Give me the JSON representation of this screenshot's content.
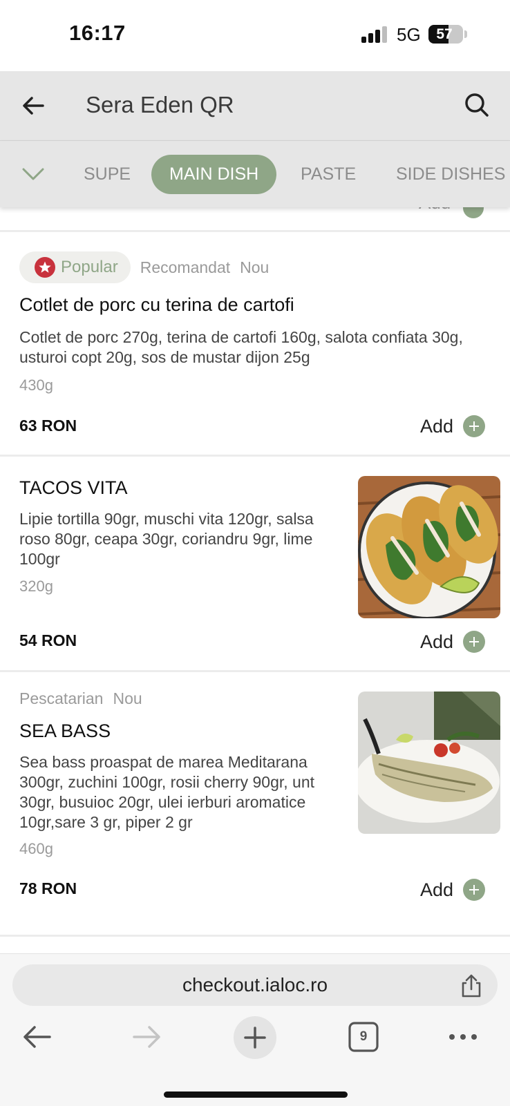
{
  "status_bar": {
    "time": "16:17",
    "network": "5G",
    "battery": "57",
    "battery_level": 0.57
  },
  "header": {
    "title": "Sera Eden QR",
    "back_icon": "arrow-left-icon",
    "search_icon": "search-icon"
  },
  "categories": {
    "chevron_icon": "chevron-down-icon",
    "items": [
      {
        "label": "SUPE",
        "active": false
      },
      {
        "label": "MAIN DISH",
        "active": true
      },
      {
        "label": "PASTE",
        "active": false
      },
      {
        "label": "SIDE DISHES",
        "active": false
      }
    ]
  },
  "peek_item": {
    "add_label": "Add"
  },
  "menu_items": [
    {
      "tags": [
        "Popular",
        "Recomandat",
        "Nou"
      ],
      "title": "Cotlet de porc cu terina de cartofi",
      "description_lines": [
        "Cotlet de porc 270g, terina de cartofi 160g, salota confiata 30g,",
        "usturoi copt 20g,  sos de mustar dijon 25g"
      ],
      "weight": "430g",
      "price": "63 RON",
      "add_label": "Add"
    },
    {
      "tags": [],
      "title": "TACOS VITA",
      "description_lines": [
        "Lipie tortilla 90gr, muschi vita 120gr, salsa",
        "roso 80gr, ceapa 30gr, coriandru 9gr, lime",
        "100gr"
      ],
      "weight": "320g",
      "price": "54 RON",
      "add_label": "Add",
      "photo": "tacos-photo"
    },
    {
      "tags": [
        "Pescatarian",
        "Nou"
      ],
      "title": "SEA BASS",
      "description_lines": [
        "Sea bass proaspat de marea Meditarana",
        "300gr, zuchini 100gr, rosii cherry 90gr, unt",
        "30gr, busuioc 20gr, ulei ierburi aromatice",
        "10gr,sare 3 gr, piper 2 gr"
      ],
      "weight": "460g",
      "price": "78 RON",
      "add_label": "Add",
      "photo": "sea-bass-photo"
    }
  ],
  "browser": {
    "url": "checkout.ialoc.ro",
    "tab_count": "9",
    "icons": [
      "share-icon",
      "back-arrow-icon",
      "forward-arrow-icon",
      "new-tab-plus-icon",
      "tabs-icon",
      "more-icon"
    ]
  },
  "colors": {
    "accent": "#8fa687",
    "popular_badge": "#c8323d",
    "header_bg": "#e6e6e6"
  }
}
